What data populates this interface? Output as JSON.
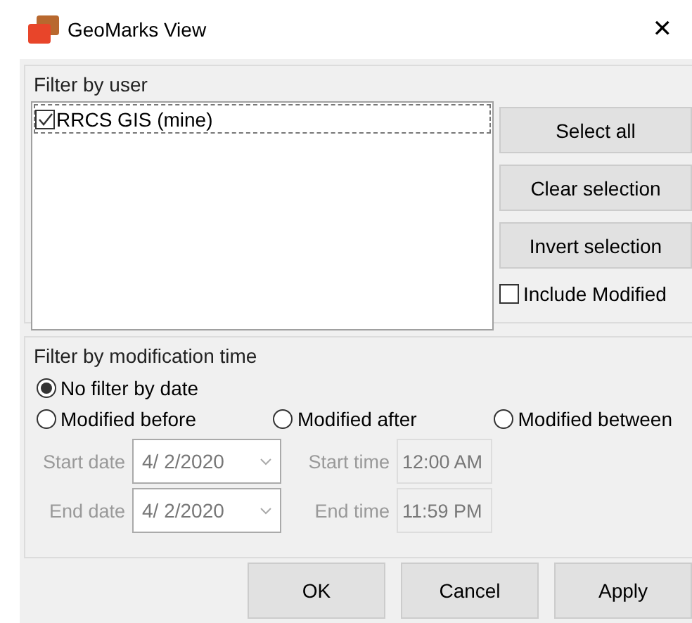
{
  "window": {
    "title": "GeoMarks View",
    "close": "✕"
  },
  "user_filter": {
    "title": "Filter by user",
    "users": [
      {
        "label": "RRCS GIS (mine)",
        "checked": true,
        "selected": true
      }
    ],
    "buttons": [
      "Select all",
      "Clear selection",
      "Invert selection"
    ],
    "include_modified": {
      "label": "Include Modified",
      "checked": false
    }
  },
  "time_filter": {
    "title": "Filter by modification time",
    "options": [
      {
        "label": "No filter by date",
        "selected": true
      },
      {
        "label": "Modified before",
        "selected": false
      },
      {
        "label": "Modified after",
        "selected": false
      },
      {
        "label": "Modified between",
        "selected": false
      }
    ],
    "disabled": true,
    "rows": [
      {
        "date_label": "Start date",
        "date": "4/  2/2020",
        "time_label": "Start time",
        "time": "12:00 AM"
      },
      {
        "date_label": "End date",
        "date": "4/  2/2020",
        "time_label": "End time",
        "time": "11:59 PM"
      }
    ]
  },
  "buttons": [
    "OK",
    "Cancel",
    "Apply"
  ]
}
